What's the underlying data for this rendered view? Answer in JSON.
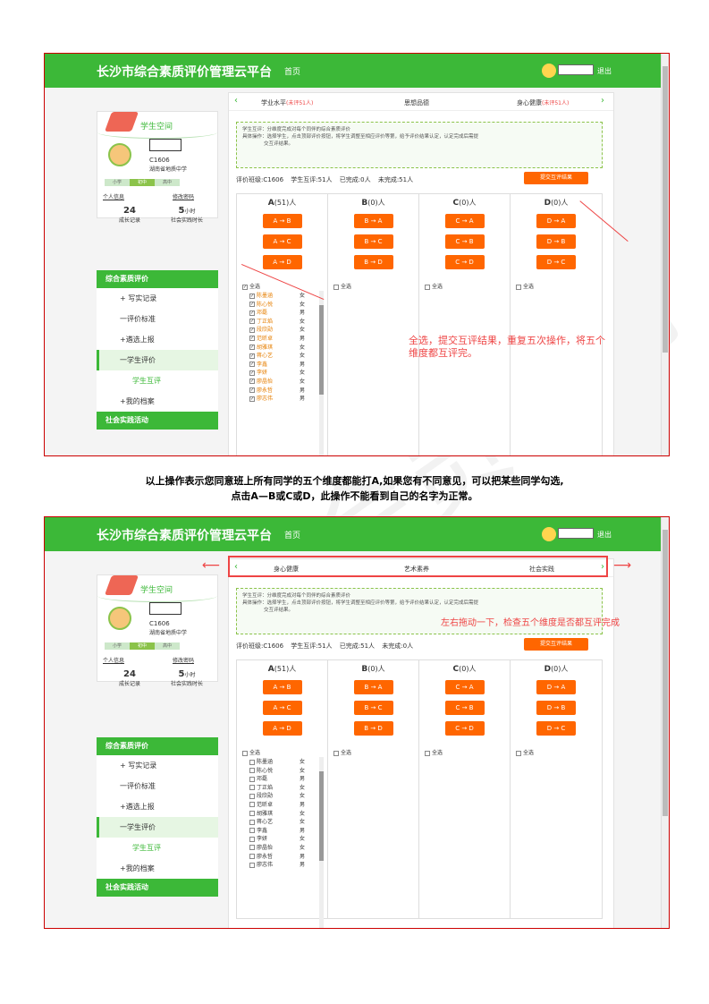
{
  "header": {
    "title": "长沙市综合素质评价管理云平台",
    "home": "首页",
    "logout": "退出"
  },
  "student": {
    "space_label": "学生空间",
    "class": "C1606",
    "school": "湖南省地质中学",
    "levels": [
      "小学",
      "初中",
      "高中"
    ],
    "personal_info": "个人信息",
    "change_pwd": "修改密码",
    "growth_count": "24",
    "growth_label": "成长记录",
    "practice_hours": "5",
    "practice_unit": "小时",
    "practice_label": "社会实践时长"
  },
  "menu": {
    "section1": "综合素质评价",
    "items": [
      "+ 写实记录",
      "一评价标准",
      "+遴选上报",
      "一学生评价",
      "学生互评",
      "+我的档案"
    ],
    "section2": "社会实践活动"
  },
  "screen1": {
    "tabs": [
      {
        "label": "学业水平",
        "note": "(未评51人)"
      },
      {
        "label": "思想品德",
        "note": ""
      },
      {
        "label": "身心健康",
        "note": "(未评51人)"
      }
    ],
    "instructions": [
      "学生互评：分维度完成对每个同伴的综合素质评价",
      "具体操作：选择学生，点击顶部评价按钮，将学生调整至相应评价等第，给予评价结果认定，认定完成后需提",
      "交互评结果。"
    ],
    "summary": "评价班级:C1606 学生互评:51人 已完成:0人 未完成:51人",
    "submit": "提交互评结果",
    "columns": [
      {
        "grade": "A",
        "count": "(51)人",
        "buttons": [
          "A → B",
          "A → C",
          "A → D"
        ]
      },
      {
        "grade": "B",
        "count": "(0)人",
        "buttons": [
          "B → A",
          "B → C",
          "B → D"
        ]
      },
      {
        "grade": "C",
        "count": "(0)人",
        "buttons": [
          "C → A",
          "C → B",
          "C → D"
        ]
      },
      {
        "grade": "D",
        "count": "(0)人",
        "buttons": [
          "D → A",
          "D → B",
          "D → C"
        ]
      }
    ],
    "select_all": "全选",
    "annotation": "全选，提交互评结果，重复五次操作，将五个维度都互评完。"
  },
  "students": [
    {
      "name": "陈墨涵",
      "gender": "女"
    },
    {
      "name": "陈心悦",
      "gender": "女"
    },
    {
      "name": "邓磊",
      "gender": "男"
    },
    {
      "name": "丁正焰",
      "gender": "女"
    },
    {
      "name": "段欣勋",
      "gender": "女"
    },
    {
      "name": "范昕卓",
      "gender": "男"
    },
    {
      "name": "胡雅琪",
      "gender": "女"
    },
    {
      "name": "蒋心艺",
      "gender": "女"
    },
    {
      "name": "李鑫",
      "gender": "男"
    },
    {
      "name": "李妍",
      "gender": "女"
    },
    {
      "name": "廖晶怡",
      "gender": "女"
    },
    {
      "name": "廖永哲",
      "gender": "男"
    },
    {
      "name": "廖志伟",
      "gender": "男"
    }
  ],
  "caption": [
    "以上操作表示您同意班上所有同学的五个维度都能打A,如果您有不同意见，可以把某些同学勾选,",
    "点击A—B或C或D，此操作不能看到自己的名字为正常。"
  ],
  "screen2": {
    "tabs": [
      {
        "label": "身心健康",
        "note": ""
      },
      {
        "label": "艺术素养",
        "note": ""
      },
      {
        "label": "社会实践",
        "note": ""
      }
    ],
    "summary": "评价班级:C1606 学生互评:51人 已完成:51人 未完成:0人",
    "annotation": "左右拖动一下，检查五个维度是否都互评完成"
  },
  "colors": {
    "brand": "#3cb838",
    "accent": "#ff6600",
    "annotation": "#ee4444"
  }
}
